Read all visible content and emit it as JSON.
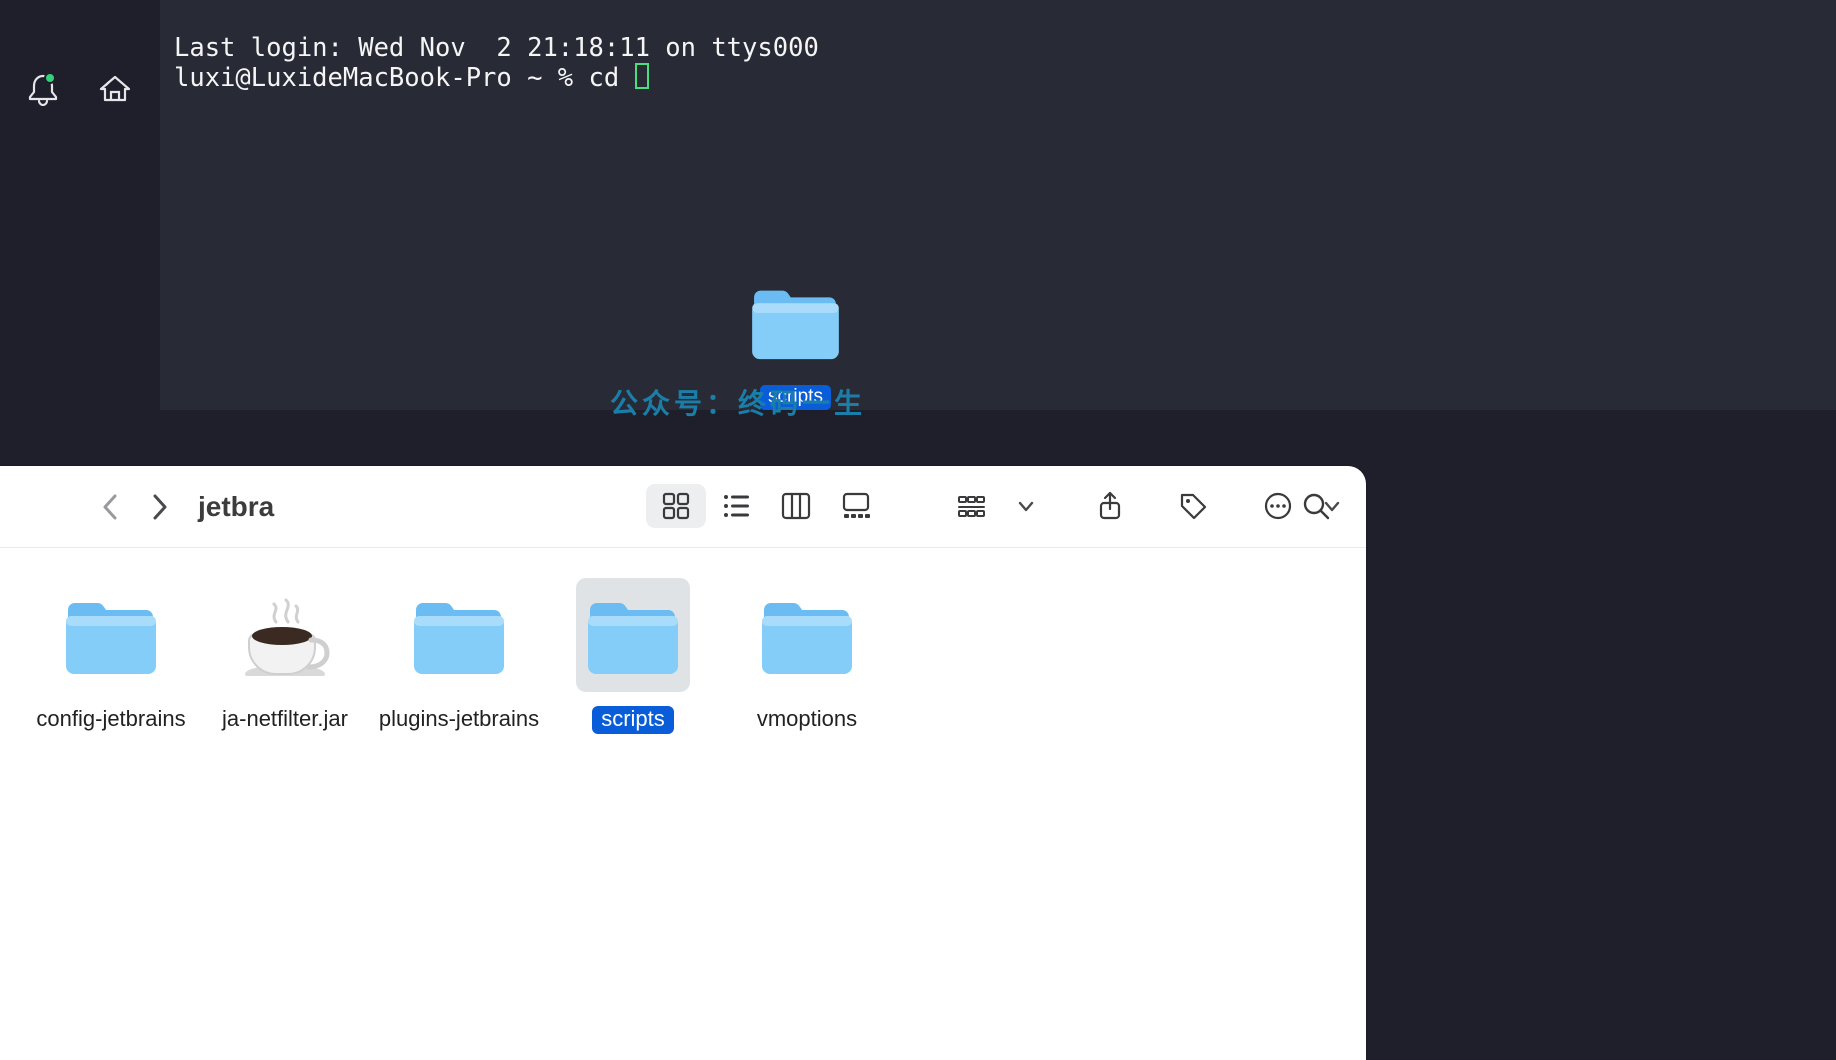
{
  "terminal": {
    "last_login_line": "Last login: Wed Nov  2 21:18:11 on ttys000",
    "prompt": "luxi@LuxideMacBook-Pro ~ % ",
    "command": "cd "
  },
  "dragged": {
    "label": "scripts"
  },
  "watermark": "公众号：终码一生",
  "finder": {
    "title": "jetbra",
    "items": [
      {
        "name": "config-jetbrains",
        "type": "folder",
        "selected": false
      },
      {
        "name": "ja-netfilter.jar",
        "type": "jar",
        "selected": false
      },
      {
        "name": "plugins-jetbrains",
        "type": "folder",
        "selected": false
      },
      {
        "name": "scripts",
        "type": "folder",
        "selected": true
      },
      {
        "name": "vmoptions",
        "type": "folder",
        "selected": false
      }
    ]
  }
}
